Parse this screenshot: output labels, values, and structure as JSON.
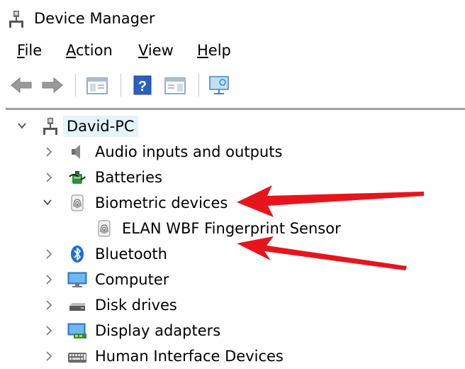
{
  "window": {
    "title": "Device Manager",
    "icon": "device-manager-icon"
  },
  "menu": [
    "File",
    "Action",
    "View",
    "Help"
  ],
  "toolbar": {
    "buttons": [
      "back-arrow-icon",
      "forward-arrow-icon",
      "console-tree-icon",
      "help-icon",
      "properties-pane-icon",
      "scan-hardware-icon"
    ]
  },
  "tree": {
    "root": "David-PC",
    "items": [
      {
        "label": "Audio inputs and outputs",
        "icon": "speaker-icon",
        "expanded": false
      },
      {
        "label": "Batteries",
        "icon": "battery-icon",
        "expanded": false
      },
      {
        "label": "Biometric devices",
        "icon": "fingerprint-icon",
        "expanded": true,
        "children": [
          {
            "label": "ELAN WBF Fingerprint Sensor",
            "icon": "fingerprint-icon"
          }
        ]
      },
      {
        "label": "Bluetooth",
        "icon": "bluetooth-icon",
        "expanded": false
      },
      {
        "label": "Computer",
        "icon": "monitor-icon",
        "expanded": false
      },
      {
        "label": "Disk drives",
        "icon": "disk-drive-icon",
        "expanded": false
      },
      {
        "label": "Display adapters",
        "icon": "display-adapter-icon",
        "expanded": false
      },
      {
        "label": "Human Interface Devices",
        "icon": "keyboard-icon",
        "expanded": false
      }
    ]
  },
  "annotations": {
    "arrow_color": "#e8141c",
    "targets": [
      "Biometric devices",
      "ELAN WBF Fingerprint Sensor"
    ]
  },
  "colors": {
    "selection": "#e5f3fb",
    "chevron": "#4d4d4d"
  }
}
